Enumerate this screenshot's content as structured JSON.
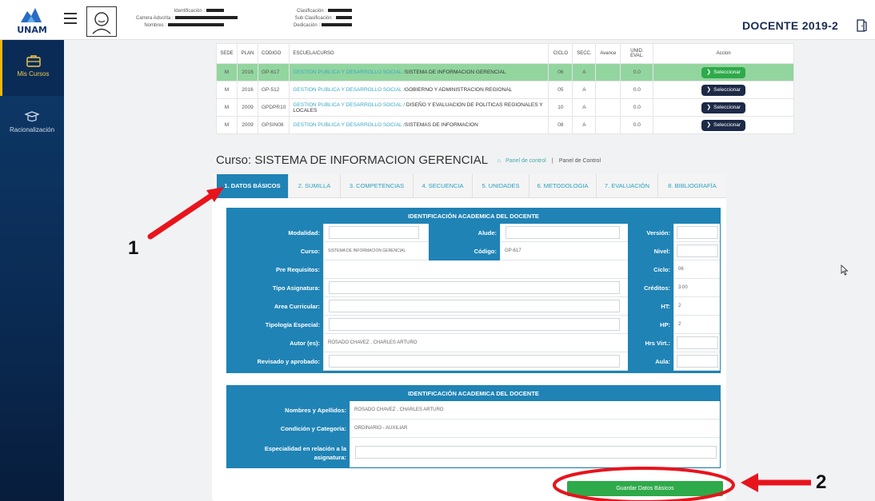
{
  "header": {
    "logo_text": "UNAM",
    "info_left": [
      {
        "label": "Identificación :"
      },
      {
        "label": "Carrera Adscrita :"
      },
      {
        "label": "Nombres :"
      }
    ],
    "info_right": [
      {
        "label": "Clasificación :"
      },
      {
        "label": "Sub Clasificación :"
      },
      {
        "label": "Dedicación :"
      }
    ],
    "title": "DOCENTE 2019-2"
  },
  "sidebar": {
    "items": [
      {
        "label": "Mis Cursos",
        "icon": "briefcase-icon",
        "active": true
      },
      {
        "label": "Racionalización",
        "icon": "graduation-cap-icon",
        "active": false
      }
    ]
  },
  "courses": {
    "headers": [
      "SEDE",
      "PLAN",
      "CODIGO",
      "ESCUELA/CURSO",
      "CICLO",
      "SECC.",
      "Avance",
      "UNID. EVAL.",
      "Accion"
    ],
    "rows": [
      {
        "sede": "M",
        "plan": "2016",
        "codigo": "GP-617",
        "escuela": "GESTION PUBLICA Y DESARROLLO SOCIAL /",
        "curso": "SISTEMA DE INFORMACION GERENCIAL",
        "ciclo": "06",
        "secc": "A",
        "avance": "",
        "unid": "0.0",
        "action": "Seleccionar",
        "selected": true
      },
      {
        "sede": "M",
        "plan": "2016",
        "codigo": "GP-512",
        "escuela": "GESTION PUBLICA Y DESARROLLO SOCIAL /",
        "curso": "GOBIERNO Y ADMINISTRACION REGIONAL",
        "ciclo": "05",
        "secc": "A",
        "avance": "",
        "unid": "0.0",
        "action": "Seleccionar",
        "selected": false
      },
      {
        "sede": "M",
        "plan": "2009",
        "codigo": "GPDPR10",
        "escuela": "GESTION PUBLICA Y DESARROLLO SOCIAL /",
        "curso": "DISEÑO Y EVALUACION DE POLITICAS REGIONALES Y LOCALES",
        "ciclo": "10",
        "secc": "A",
        "avance": "",
        "unid": "0.0",
        "action": "Seleccionar",
        "selected": false
      },
      {
        "sede": "M",
        "plan": "2009",
        "codigo": "GPSIN08",
        "escuela": "GESTION PUBLICA Y DESARROLLO SOCIAL /",
        "curso": "SISTEMAS DE INFORMACION",
        "ciclo": "08",
        "secc": "A",
        "avance": "",
        "unid": "0.0",
        "action": "Seleccionar",
        "selected": false
      }
    ]
  },
  "course_title": {
    "prefix": "Curso:",
    "name": "SISTEMA DE INFORMACION GERENCIAL",
    "link1": "Panel de control",
    "link2": "Panel de Control"
  },
  "tabs": [
    "1. DATOS BÁSICOS",
    "2. SUMILLA",
    "3. COMPETENCIAS",
    "4. SECUENCIA",
    "5. UNIDADES",
    "6. METODOLOGIA",
    "7. EVALUACIÓN",
    "8. BIBLIOGRAFÍA"
  ],
  "section1": {
    "title": "IDENTIFICACIÓN ACADEMICA DEL DOCENTE",
    "labels": {
      "modalidad": "Modalidad:",
      "alude": "Alude:",
      "version": "Versión:",
      "curso": "Curso:",
      "codigo": "Código:",
      "nivel": "Nivel:",
      "prerequisitos": "Pre Requisitos:",
      "ciclo": "Ciclo:",
      "tipo_asignatura": "Tipo Asignatura:",
      "creditos": "Créditos:",
      "area_curricular": "Area Curricular:",
      "ht": "HT:",
      "tipologia": "Tipología Especial:",
      "hp": "HP:",
      "autor": "Autor (es):",
      "hrs_virt": "Hrs Virt.:",
      "revisado": "Revisado y aprobado:",
      "aula": "Aula:"
    },
    "values": {
      "modalidad": "",
      "alude": "",
      "version": "",
      "curso": "SISTEMA DE INFORMACION GERENCIAL",
      "codigo": "GP-617",
      "nivel": "",
      "prerequisitos": "",
      "ciclo": "06",
      "tipo_asignatura": "",
      "creditos": "3.00",
      "area_curricular": "",
      "ht": "2",
      "tipologia": "",
      "hp": "2",
      "autor": "ROSADO CHAVEZ , CHARLES ARTURO",
      "hrs_virt": "",
      "revisado": "",
      "aula": ""
    }
  },
  "section2": {
    "title": "IDENTIFICACIÓN ACADEMICA DEL DOCENTE",
    "labels": {
      "nombres": "Nombres y Apellidos:",
      "condicion": "Condición y Categoría:",
      "especialidad": "Especialidad en relación a la asignatura:"
    },
    "values": {
      "nombres": "ROSADO CHAVEZ , CHARLES ARTURO",
      "condicion": "ORDINARIO - AUXILIAR",
      "especialidad": ""
    }
  },
  "save_button": "Guardar Datos Básicos",
  "annotations": {
    "one": "1",
    "two": "2"
  },
  "colors": {
    "primary": "#1f83b5",
    "green": "#2eaa4a",
    "sidebar": "#0e3a6a",
    "annotation": "#e8141c"
  }
}
